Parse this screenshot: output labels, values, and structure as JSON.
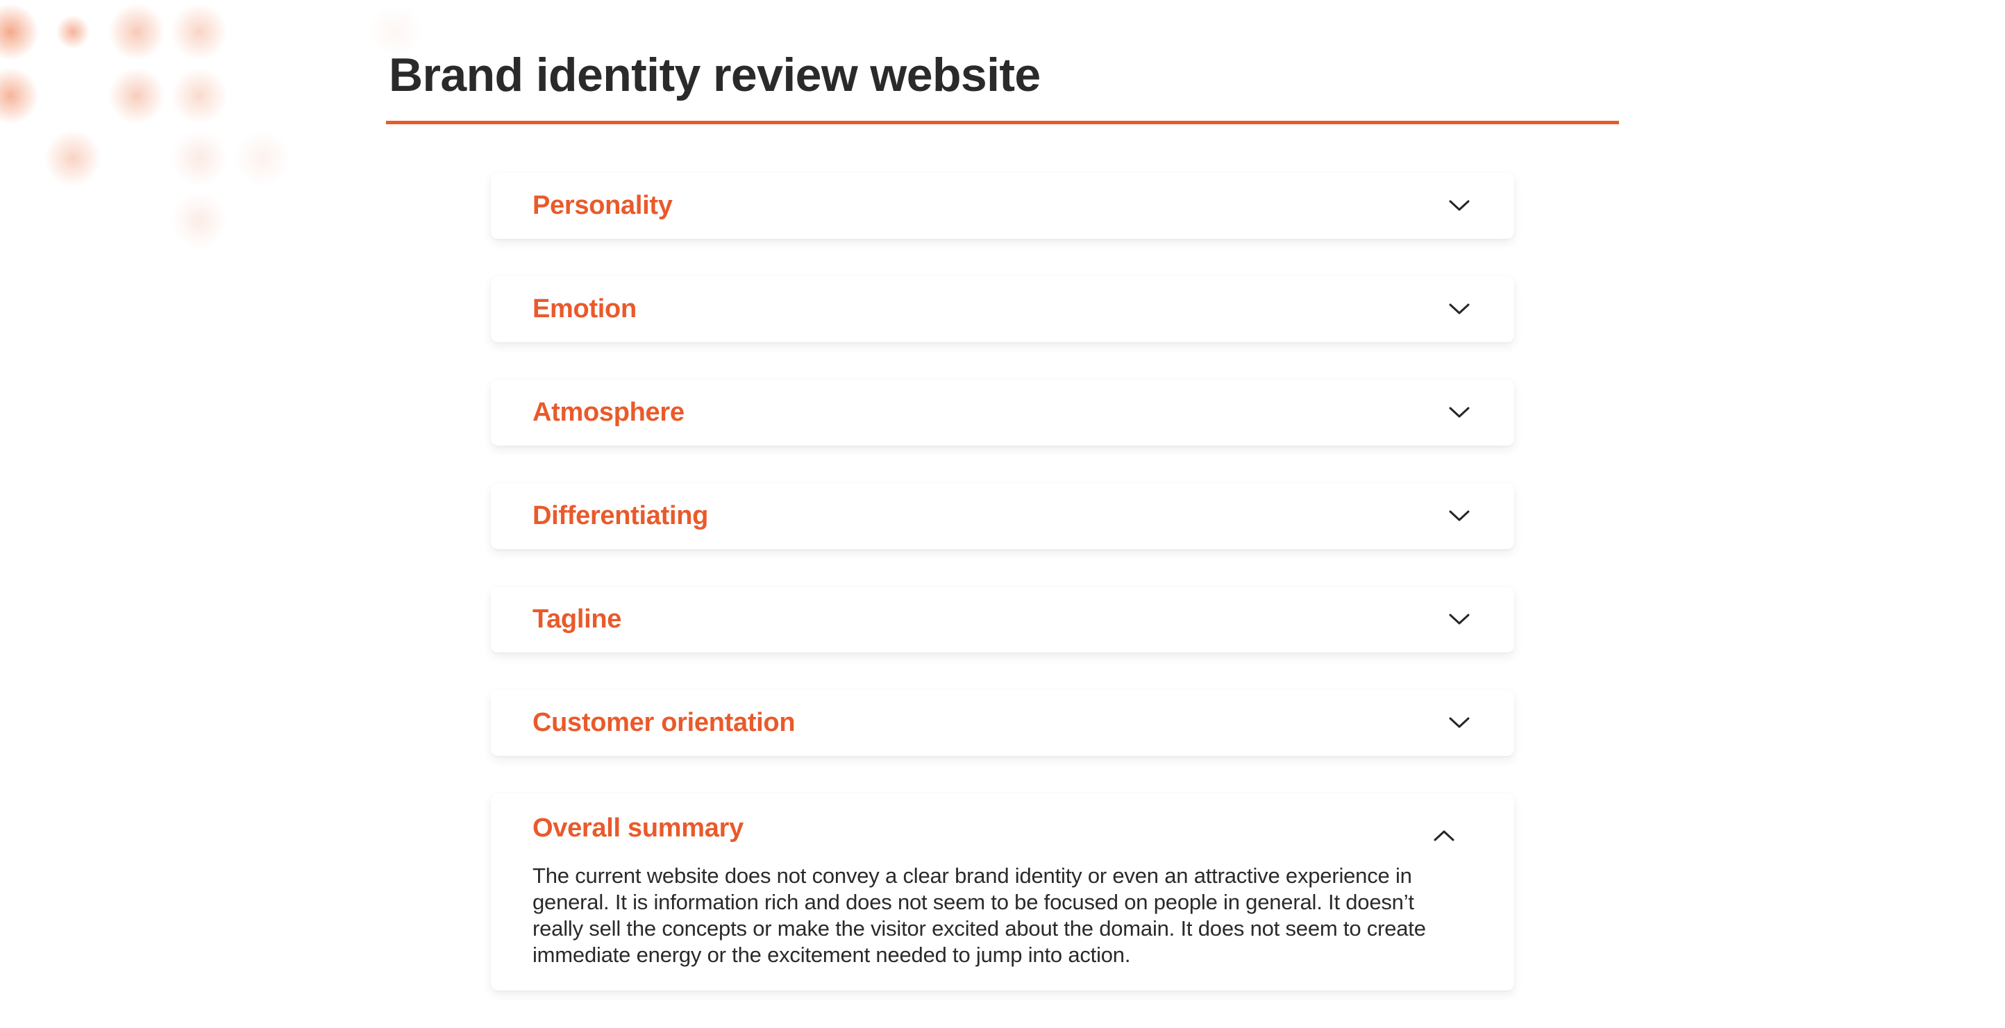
{
  "page": {
    "title": "Brand identity review website",
    "accent_color": "#E95A2B",
    "text_color": "#2a2a2a"
  },
  "accordion": {
    "items": [
      {
        "label": "Personality",
        "expanded": false,
        "icon": "chevron-down-icon"
      },
      {
        "label": "Emotion",
        "expanded": false,
        "icon": "chevron-down-icon"
      },
      {
        "label": "Atmosphere",
        "expanded": false,
        "icon": "chevron-down-icon"
      },
      {
        "label": "Differentiating",
        "expanded": false,
        "icon": "chevron-down-icon"
      },
      {
        "label": "Tagline",
        "expanded": false,
        "icon": "chevron-down-icon"
      },
      {
        "label": "Customer orientation",
        "expanded": false,
        "icon": "chevron-down-icon"
      },
      {
        "label": "Overall summary",
        "expanded": true,
        "icon": "chevron-up-icon",
        "content": "The current website does not convey a clear brand identity or even an attractive experience in general. It is information rich and does not seem to be focused on people in general. It doesn’t really sell the concepts or make the visitor excited about the domain. It does not seem to create immediate energy or the excitement needed to jump into action."
      }
    ]
  }
}
